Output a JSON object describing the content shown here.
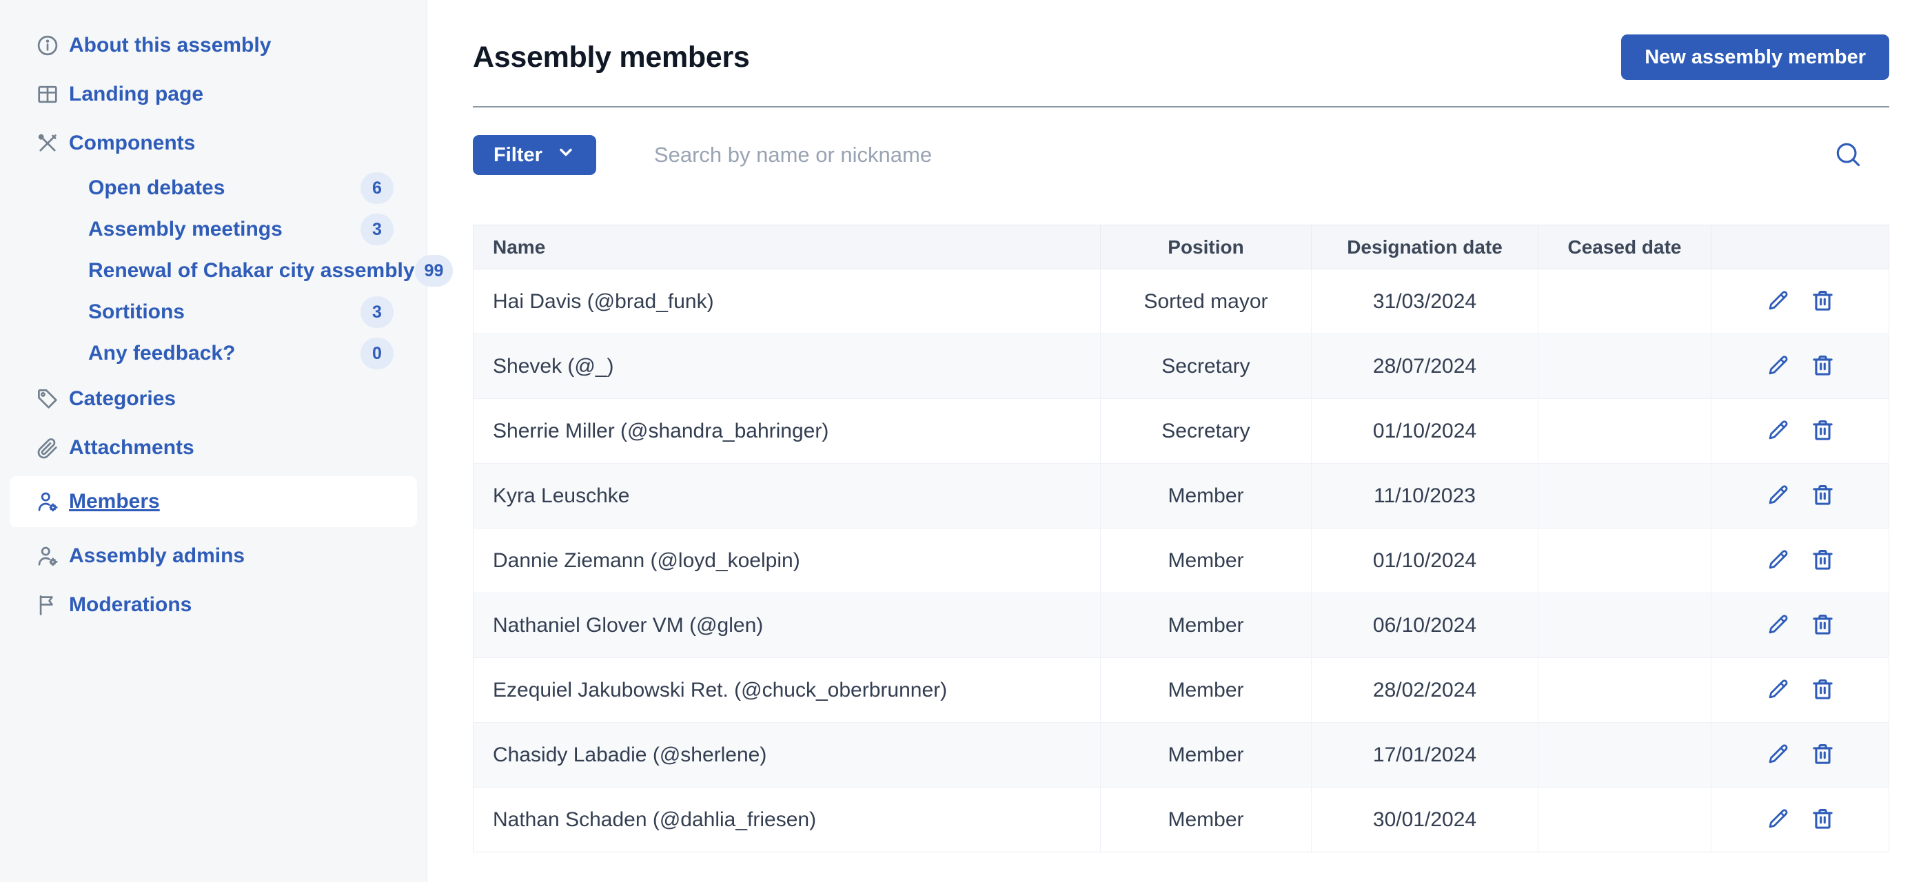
{
  "colors": {
    "accent": "#2e5cb8",
    "accent_soft": "#e3ebf9",
    "sidebar_bg": "#f5f7f9",
    "table_header_bg": "#f4f6f9",
    "row_alt_bg": "#f7f9fb",
    "divider": "#8f98a6",
    "title_text": "#101826",
    "body_text": "#333e51",
    "muted_icon": "#72808f",
    "placeholder_text": "#98a3b3"
  },
  "sidebar": {
    "items": [
      {
        "label": "About this assembly",
        "slug": "about-this-assembly",
        "icon": "info-icon",
        "indent": false,
        "active": false,
        "badge": null
      },
      {
        "label": "Landing page",
        "slug": "landing-page",
        "icon": "layout-grid-icon",
        "indent": false,
        "active": false,
        "badge": null
      },
      {
        "label": "Components",
        "slug": "components",
        "icon": "tools-icon",
        "indent": false,
        "active": false,
        "badge": null
      },
      {
        "label": "Open debates",
        "slug": "open-debates",
        "icon": null,
        "indent": true,
        "active": false,
        "badge": "6"
      },
      {
        "label": "Assembly meetings",
        "slug": "assembly-meetings",
        "icon": null,
        "indent": true,
        "active": false,
        "badge": "3"
      },
      {
        "label": "Renewal of Chakar city assembly",
        "slug": "renewal-of-chakar-city-assembly",
        "icon": null,
        "indent": true,
        "active": false,
        "badge": "99"
      },
      {
        "label": "Sortitions",
        "slug": "sortitions",
        "icon": null,
        "indent": true,
        "active": false,
        "badge": "3"
      },
      {
        "label": "Any feedback?",
        "slug": "any-feedback",
        "icon": null,
        "indent": true,
        "active": false,
        "badge": "0"
      },
      {
        "label": "Categories",
        "slug": "categories",
        "icon": "tag-icon",
        "indent": false,
        "active": false,
        "badge": null
      },
      {
        "label": "Attachments",
        "slug": "attachments",
        "icon": "paperclip-icon",
        "indent": false,
        "active": false,
        "badge": null
      },
      {
        "label": "Members",
        "slug": "members",
        "icon": "user-gear-icon",
        "indent": false,
        "active": true,
        "badge": null
      },
      {
        "label": "Assembly admins",
        "slug": "assembly-admins",
        "icon": "user-gear-icon",
        "indent": false,
        "active": false,
        "badge": null
      },
      {
        "label": "Moderations",
        "slug": "moderations",
        "icon": "flag-icon",
        "indent": false,
        "active": false,
        "badge": null
      }
    ]
  },
  "header": {
    "title": "Assembly members",
    "new_button_label": "New assembly member"
  },
  "toolbar": {
    "filter_label": "Filter",
    "filter_chevron_icon": "chevron-down-icon",
    "search_placeholder": "Search by name or nickname",
    "search_icon": "search-icon"
  },
  "table": {
    "columns": [
      "Name",
      "Position",
      "Designation date",
      "Ceased date",
      ""
    ],
    "row_action_icons": [
      "pencil-icon",
      "trash-icon"
    ],
    "rows": [
      {
        "name": "Hai Davis (@brad_funk)",
        "position": "Sorted mayor",
        "designation_date": "31/03/2024",
        "ceased_date": ""
      },
      {
        "name": "Shevek (@_)",
        "position": "Secretary",
        "designation_date": "28/07/2024",
        "ceased_date": ""
      },
      {
        "name": "Sherrie Miller (@shandra_bahringer)",
        "position": "Secretary",
        "designation_date": "01/10/2024",
        "ceased_date": ""
      },
      {
        "name": "Kyra Leuschke",
        "position": "Member",
        "designation_date": "11/10/2023",
        "ceased_date": ""
      },
      {
        "name": "Dannie Ziemann (@loyd_koelpin)",
        "position": "Member",
        "designation_date": "01/10/2024",
        "ceased_date": ""
      },
      {
        "name": "Nathaniel Glover VM (@glen)",
        "position": "Member",
        "designation_date": "06/10/2024",
        "ceased_date": ""
      },
      {
        "name": "Ezequiel Jakubowski Ret. (@chuck_oberbrunner)",
        "position": "Member",
        "designation_date": "28/02/2024",
        "ceased_date": ""
      },
      {
        "name": "Chasidy Labadie (@sherlene)",
        "position": "Member",
        "designation_date": "17/01/2024",
        "ceased_date": ""
      },
      {
        "name": "Nathan Schaden (@dahlia_friesen)",
        "position": "Member",
        "designation_date": "30/01/2024",
        "ceased_date": ""
      }
    ]
  }
}
